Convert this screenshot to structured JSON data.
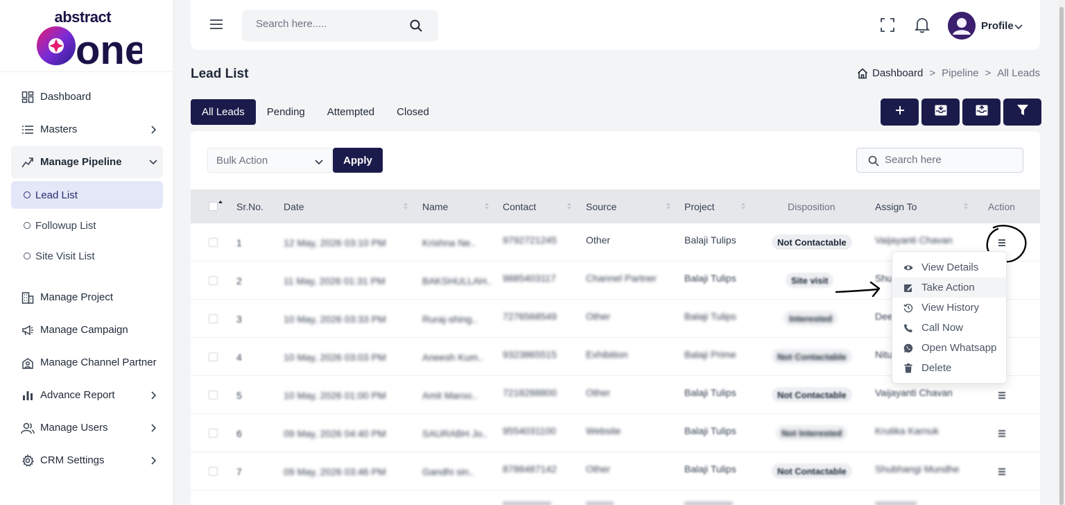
{
  "brand": {
    "small": "abstract",
    "big": "one"
  },
  "sidebar": {
    "items": [
      {
        "label": "Dashboard"
      },
      {
        "label": "Masters"
      },
      {
        "label": "Manage Pipeline"
      },
      {
        "label": "Lead List"
      },
      {
        "label": "Followup List"
      },
      {
        "label": "Site Visit List"
      },
      {
        "label": "Manage Project"
      },
      {
        "label": "Manage Campaign"
      },
      {
        "label": "Manage Channel Partner"
      },
      {
        "label": "Advance Report"
      },
      {
        "label": "Manage Users"
      },
      {
        "label": "CRM Settings"
      }
    ]
  },
  "topbar": {
    "search_placeholder": "Search here.....",
    "profile_label": "Profile"
  },
  "page": {
    "title": "Lead List"
  },
  "breadcrumb": {
    "items": [
      "Dashboard",
      "Pipeline",
      "All Leads"
    ],
    "sep": ">"
  },
  "tabs": [
    {
      "label": "All Leads"
    },
    {
      "label": "Pending"
    },
    {
      "label": "Attempted"
    },
    {
      "label": "Closed"
    }
  ],
  "toolbar": {
    "bulk_label": "Bulk Action",
    "apply_label": "Apply",
    "search_placeholder": "Search here"
  },
  "table": {
    "columns": [
      "Sr.No.",
      "Date",
      "Name",
      "Contact",
      "Source",
      "Project",
      "Disposition",
      "Assign To",
      "Action"
    ],
    "rows": [
      {
        "sr": "1",
        "date": "12 May, 2026 03:10 PM",
        "name": "Krishna Ne..",
        "contact": "9792721245",
        "source": "Other",
        "project": "Balaji Tulips",
        "disposition": "Not Contactable",
        "assign": "Vaijayanti Chavan"
      },
      {
        "sr": "2",
        "date": "11 May, 2026 01:31 PM",
        "name": "BAKSHULLAH..",
        "contact": "9885403117",
        "source": "Channel Partner",
        "project": "Balaji Tulips",
        "disposition": "Site visit",
        "assign": "Shu"
      },
      {
        "sr": "3",
        "date": "10 May, 2026 03:33 PM",
        "name": "Ruraj-shing..",
        "contact": "7276568549",
        "source": "Other",
        "project": "Balaji Tulips",
        "disposition": "Interested",
        "assign": "Dee"
      },
      {
        "sr": "4",
        "date": "10 May, 2026 03:03 PM",
        "name": "Aneesh Kum..",
        "contact": "9323865515",
        "source": "Exhibition",
        "project": "Balaji Prime",
        "disposition": "Not Contactable",
        "assign": "Nitu"
      },
      {
        "sr": "5",
        "date": "10 May, 2026 01:00 PM",
        "name": "Amit Maroo..",
        "contact": "7218288800",
        "source": "Other",
        "project": "Balaji Tulips",
        "disposition": "Not Contactable",
        "assign": "Vaijayanti Chavan"
      },
      {
        "sr": "6",
        "date": "09 May, 2026 04:40 PM",
        "name": "SAURABH Jo..",
        "contact": "9554031100",
        "source": "Website",
        "project": "Balaji Tulips",
        "disposition": "Not Interested",
        "assign": "Krutika Karnuk"
      },
      {
        "sr": "7",
        "date": "09 May, 2026 03:46 PM",
        "name": "Gandhi sin..",
        "contact": "8788487142",
        "source": "Other",
        "project": "Balaji Tulips",
        "disposition": "Not Contactable",
        "assign": "Shubhangi Mundhe"
      }
    ]
  },
  "action_menu": {
    "items": [
      {
        "label": "View Details",
        "icon": "eye-icon"
      },
      {
        "label": "Take Action",
        "icon": "edit-icon"
      },
      {
        "label": "View History",
        "icon": "history-icon"
      },
      {
        "label": "Call Now",
        "icon": "phone-icon"
      },
      {
        "label": "Open Whatsapp",
        "icon": "whatsapp-icon"
      },
      {
        "label": "Delete",
        "icon": "trash-icon"
      }
    ]
  },
  "colors": {
    "primary": "#1b1b4b",
    "active_sub_bg": "#e3e7f8",
    "table_head": "#e5e7eb"
  }
}
